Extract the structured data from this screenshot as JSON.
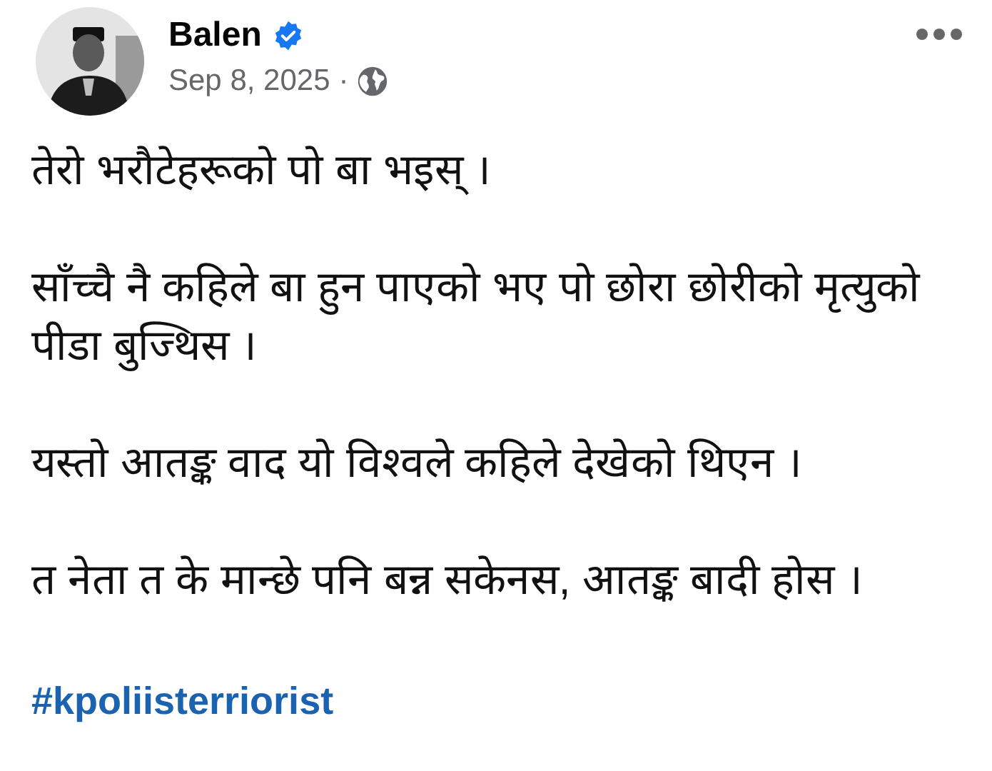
{
  "post": {
    "author": "Balen",
    "verified": true,
    "date": "Sep 8, 2025",
    "separator": "·",
    "paragraphs": [
      "तेरो भरौटेहरूको पो बा भइस् ।",
      "साँच्चै नै कहिले बा हुन पाएको  भए पो छोरा छोरीको मृत्युको पीडा बुज्थिस ।",
      "यस्तो आतङ्क वाद यो विश्वले कहिले देखेको थिएन ।",
      "त नेता त के मान्छे पनि बन्न सकेनस, आतङ्क बादी होस ।"
    ],
    "hashtag": "#kpoliisterriorist"
  }
}
